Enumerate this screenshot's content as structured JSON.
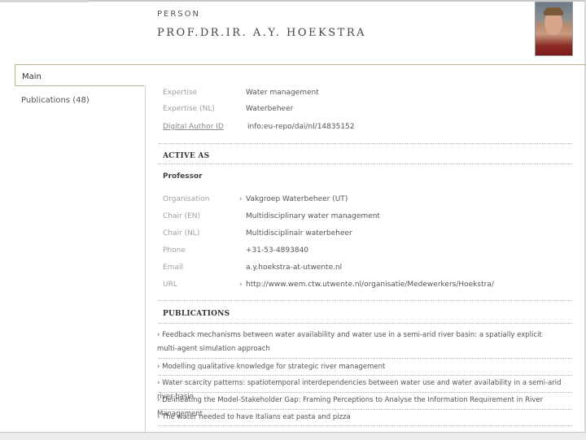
{
  "header": {
    "label": "PERSON",
    "name": "PROF.DR.IR. A.Y. HOEKSTRA"
  },
  "tabs": {
    "main": "Main",
    "publications": "Publications (48)"
  },
  "profile": [
    {
      "label": "Expertise",
      "value": "Water management"
    },
    {
      "label": "Expertise (NL)",
      "value": "Waterbeheer"
    },
    {
      "label": "Digital Author ID",
      "value": "info:eu-repo/dai/nl/14835152"
    }
  ],
  "active_as": {
    "title": "ACTIVE AS",
    "role": "Professor",
    "organisation": {
      "label": "Organisation",
      "value": "Vakgroep Waterbeheer (UT)"
    },
    "chair_en": {
      "label": "Chair (EN)",
      "value": "Multidisciplinary water management"
    },
    "chair_nl": {
      "label": "Chair (NL)",
      "value": "Multidisciplinair waterbeheer"
    },
    "phone": {
      "label": "Phone",
      "value": "+31-53-4893840"
    },
    "email": {
      "label": "Email",
      "value": "a.y.hoekstra-at-utwente.nl"
    },
    "url": {
      "label": "URL",
      "value": "http://www.wem.ctw.utwente.nl/organisatie/Medewerkers/Hoekstra/"
    }
  },
  "publications": {
    "title": "PUBLICATIONS",
    "items": [
      "Feedback mechanisms between water availability and water use in a semi-arid river basin: a spatially explicit multi-agent simulation approach",
      "Modelling qualitative knowledge for strategic river management",
      "Water scarcity patterns: spatiotemporal interdependencies between water use and water availability in a semi-arid river basin",
      "Delineating the Model-Stakeholder Gap: Framing Perceptions to Analyse the Information Requirement in River Management",
      "The water needed to have Italians eat pasta and pizza"
    ]
  },
  "icons": {
    "arrow": "chevron-right-icon",
    "photo": "person-photo"
  }
}
